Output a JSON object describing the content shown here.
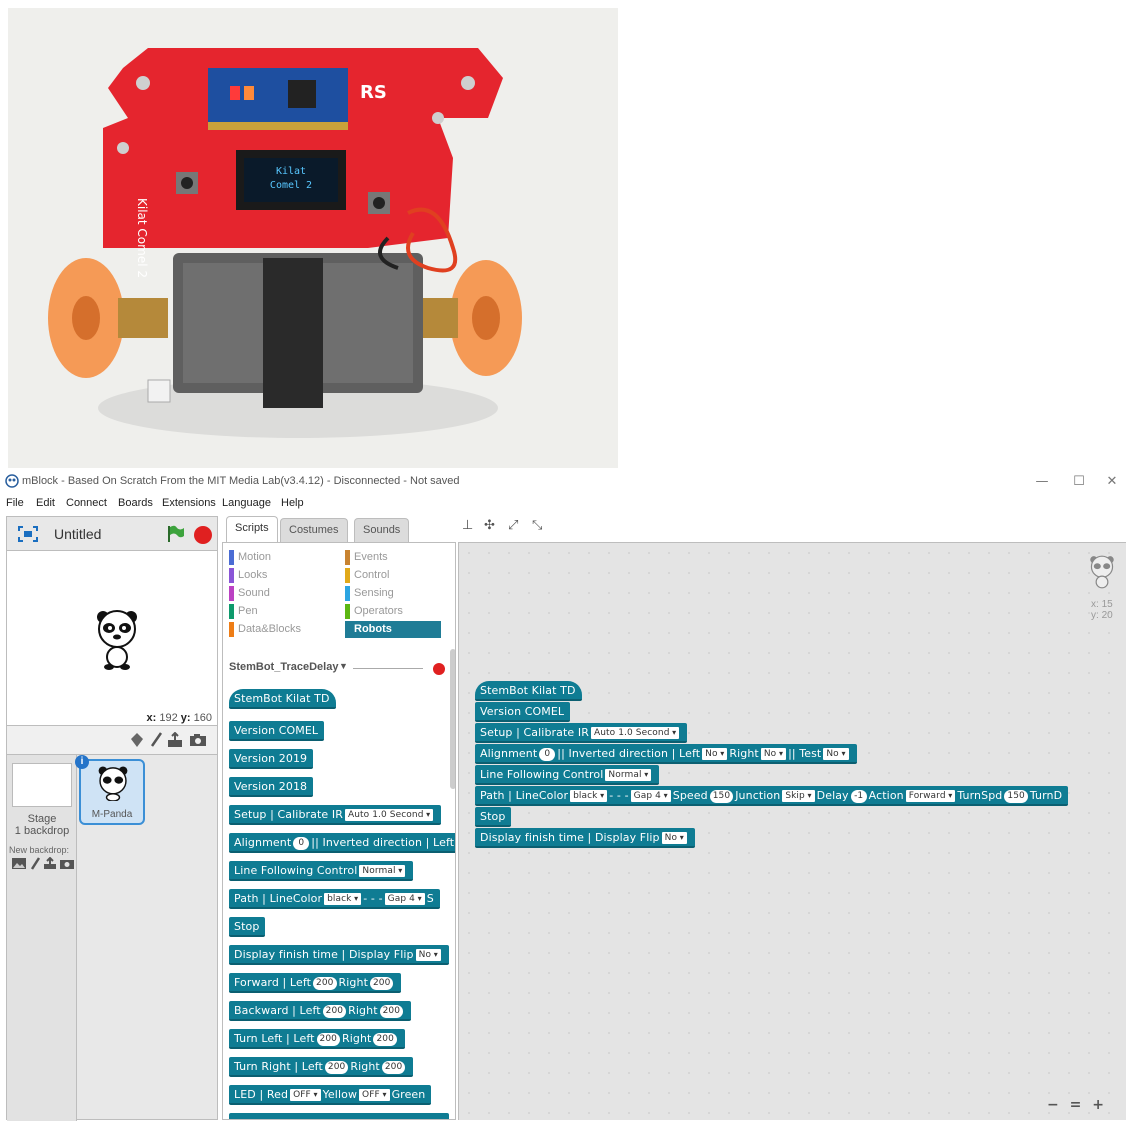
{
  "window": {
    "title": "mBlock - Based On Scratch From the MIT Media Lab(v3.4.12) - Disconnected - Not saved",
    "minimize": "—",
    "maximize": "☐",
    "close": "✕"
  },
  "photo": {
    "oled_line1": "Kilat",
    "oled_line2": "Comel 2",
    "board_label": "Kilat Comel 2",
    "brand": "RS"
  },
  "menu": [
    "File",
    "Edit",
    "Connect",
    "Boards",
    "Extensions",
    "Language",
    "Help"
  ],
  "stage": {
    "name": "Untitled",
    "x_label": "x:",
    "x_value": "192",
    "y_label": "y:",
    "y_value": "160",
    "stage_label": "Stage",
    "backdrops": "1 backdrop",
    "new_backdrop": "New backdrop:",
    "sprite_name": "M-Panda"
  },
  "tabs": [
    "Scripts",
    "Costumes",
    "Sounds"
  ],
  "categories": {
    "left": [
      "Motion",
      "Looks",
      "Sound",
      "Pen",
      "Data&Blocks"
    ],
    "right": [
      "Events",
      "Control",
      "Sensing",
      "Operators",
      "Robots"
    ],
    "colors": {
      "Motion": "#4a6cd4",
      "Looks": "#8a55d7",
      "Sound": "#bb42c3",
      "Pen": "#0e9a6c",
      "Data&Blocks": "#ee7d16",
      "Events": "#c88330",
      "Control": "#e1a91a",
      "Sensing": "#2ca5e2",
      "Operators": "#5cb712",
      "Robots": "#1f7c96"
    },
    "active": "Robots"
  },
  "extension": {
    "name": "StemBot_TraceDelay",
    "status_color": "#e02020"
  },
  "palette_blocks": {
    "b1": "StemBot Kilat TD",
    "b2": "Version COMEL",
    "b3": "Version 2019",
    "b4": "Version 2018",
    "setup": {
      "label": "Setup | Calibrate IR",
      "dd": "Auto 1.0 Second"
    },
    "align": {
      "label": "Alignment",
      "num": "0",
      "rest": "|| Inverted direction | Left"
    },
    "lfc": {
      "label": "Line Following Control",
      "dd": "Normal"
    },
    "path": {
      "label": "Path | LineColor",
      "dd1": "black",
      "sep": "- - -",
      "dd2": "Gap 4",
      "tail": "S"
    },
    "stop": "Stop",
    "display": {
      "label": "Display finish time | Display Flip",
      "dd": "No"
    },
    "forward": {
      "label": "Forward | Left",
      "n1": "200",
      "mid": "Right",
      "n2": "200"
    },
    "backward": {
      "label": "Backward | Left",
      "n1": "200",
      "mid": "Right",
      "n2": "200"
    },
    "turnleft": {
      "label": "Turn Left | Left",
      "n1": "200",
      "mid": "Right",
      "n2": "200"
    },
    "turnright": {
      "label": "Turn Right | Left",
      "n1": "200",
      "mid": "Right",
      "n2": "200"
    },
    "led": {
      "label": "LED | Red",
      "dd1": "OFF",
      "mid1": "Yellow",
      "dd2": "OFF",
      "mid2": "Green"
    }
  },
  "script": {
    "s1": "StemBot Kilat TD",
    "s2": "Version COMEL",
    "setup": {
      "label": "Setup | Calibrate IR",
      "dd": "Auto 1.0 Second"
    },
    "align": {
      "label": "Alignment",
      "num": "0",
      "t1": "|| Inverted direction | Left",
      "dd1": "No",
      "t2": "Right",
      "dd2": "No",
      "t3": "|| Test",
      "dd3": "No"
    },
    "lfc": {
      "label": "Line Following Control",
      "dd": "Normal"
    },
    "path": {
      "label": "Path | LineColor",
      "dd1": "black",
      "sep": "- - -",
      "dd2": "Gap 4",
      "t1": "Speed",
      "n1": "150",
      "t2": "Junction",
      "dd3": "Skip",
      "t3": "Delay",
      "n2": "-1",
      "t4": "Action",
      "dd4": "Forward",
      "t5": "TurnSpd",
      "n3": "150",
      "t6": "TurnD"
    },
    "stop": "Stop",
    "display": {
      "label": "Display finish time | Display Flip",
      "dd": "No"
    }
  },
  "sprite_info": {
    "x_label": "x:",
    "x": "15",
    "y_label": "y:",
    "y": "20"
  },
  "zoom": {
    "out": "−",
    "reset": "=",
    "in": "+"
  }
}
